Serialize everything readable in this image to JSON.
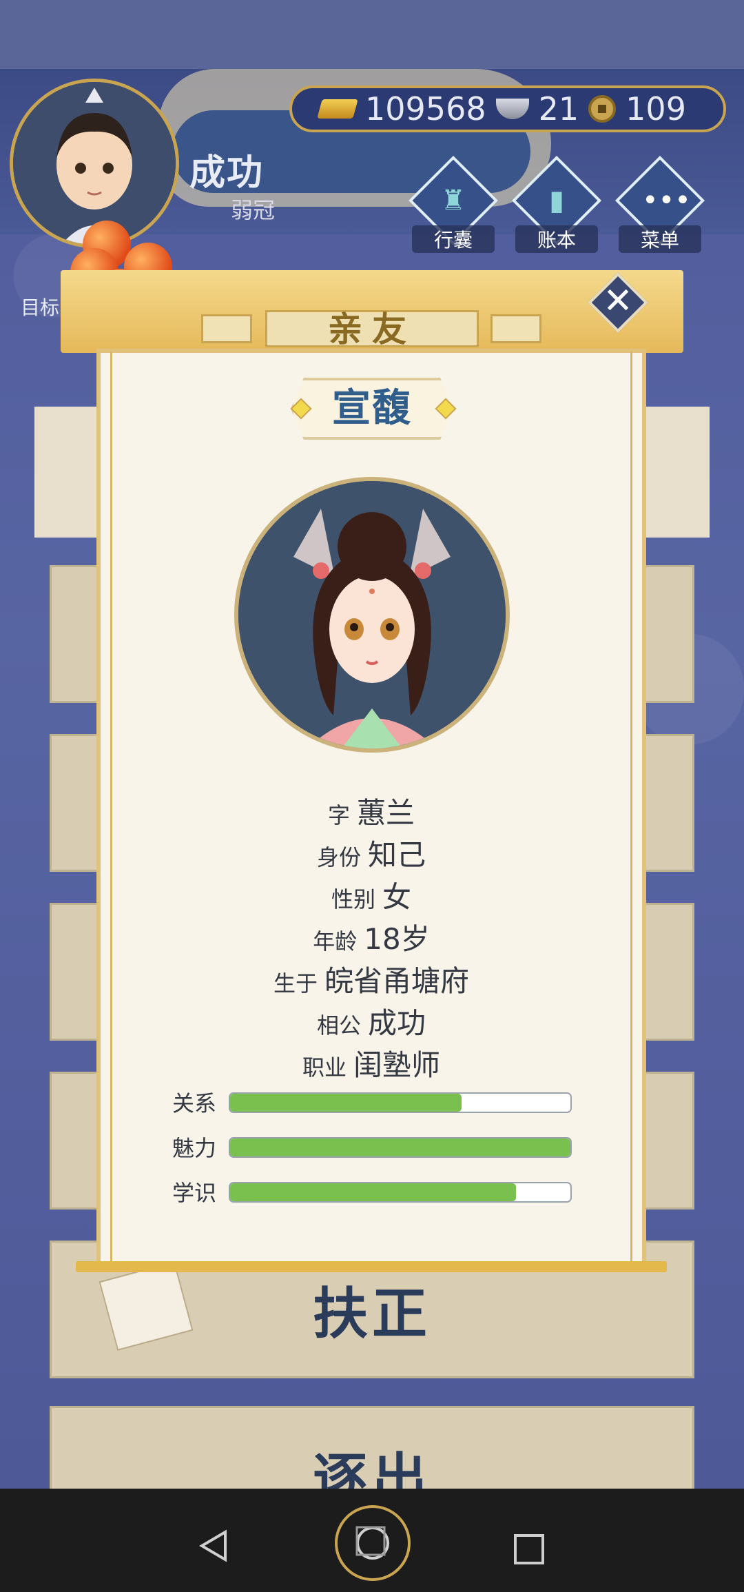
{
  "player": {
    "name": "成功",
    "rank": "弱冠"
  },
  "currency": {
    "gold": "109568",
    "silver": "21",
    "coins": "109"
  },
  "top_buttons": [
    {
      "label": "行囊"
    },
    {
      "label": "账本"
    },
    {
      "label": "菜单"
    }
  ],
  "sidebar": {
    "target_label": "目标"
  },
  "dialog": {
    "title": "亲友",
    "character_name": "宣馥",
    "info": [
      {
        "label": "字",
        "value": "蕙兰"
      },
      {
        "label": "身份",
        "value": "知己"
      },
      {
        "label": "性别",
        "value": "女"
      },
      {
        "label": "年龄",
        "value": "18岁"
      },
      {
        "label": "生于",
        "value": "皖省甬塘府"
      },
      {
        "label": "相公",
        "value": "成功"
      },
      {
        "label": "职业",
        "value": "闺塾师"
      }
    ],
    "stats": [
      {
        "label": "关系",
        "fraction": 0.68
      },
      {
        "label": "魅力",
        "fraction": 1.0
      },
      {
        "label": "学识",
        "fraction": 0.84
      }
    ]
  },
  "actions": {
    "promote_label": "扶正",
    "expel_label": "逐出"
  }
}
